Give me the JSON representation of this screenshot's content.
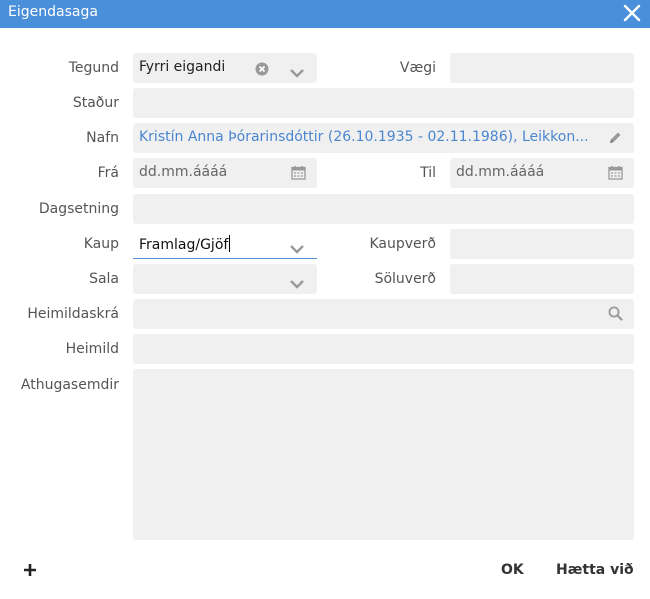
{
  "window": {
    "title": "Eigendasaga"
  },
  "labels": {
    "tegund": "Tegund",
    "vaegi": "Vægi",
    "stadur": "Staður",
    "nafn": "Nafn",
    "fra": "Frá",
    "til": "Til",
    "dagsetning": "Dagsetning",
    "kaup": "Kaup",
    "kaupverd": "Kaupverð",
    "sala": "Sala",
    "soluverd": "Söluverð",
    "heimildaskra": "Heimildaskrá",
    "heimild": "Heimild",
    "athugasemdir": "Athugasemdir"
  },
  "values": {
    "tegund": "Fyrri eigandi",
    "vaegi": "",
    "stadur": "",
    "nafn": "Kristín Anna Þórarinsdóttir (26.10.1935 - 02.11.1986), Leikkon...",
    "kaup": "Framlag/Gjöf",
    "kaupverd": "",
    "sala": "",
    "soluverd": "",
    "dagsetning": "",
    "heimildaskra": "",
    "heimild": "",
    "athugasemdir": ""
  },
  "placeholders": {
    "fra": "dd.mm.áááá",
    "til": "dd.mm.áááá"
  },
  "footer": {
    "add_icon": "plus-icon",
    "ok": "OK",
    "cancel": "Hætta við"
  }
}
